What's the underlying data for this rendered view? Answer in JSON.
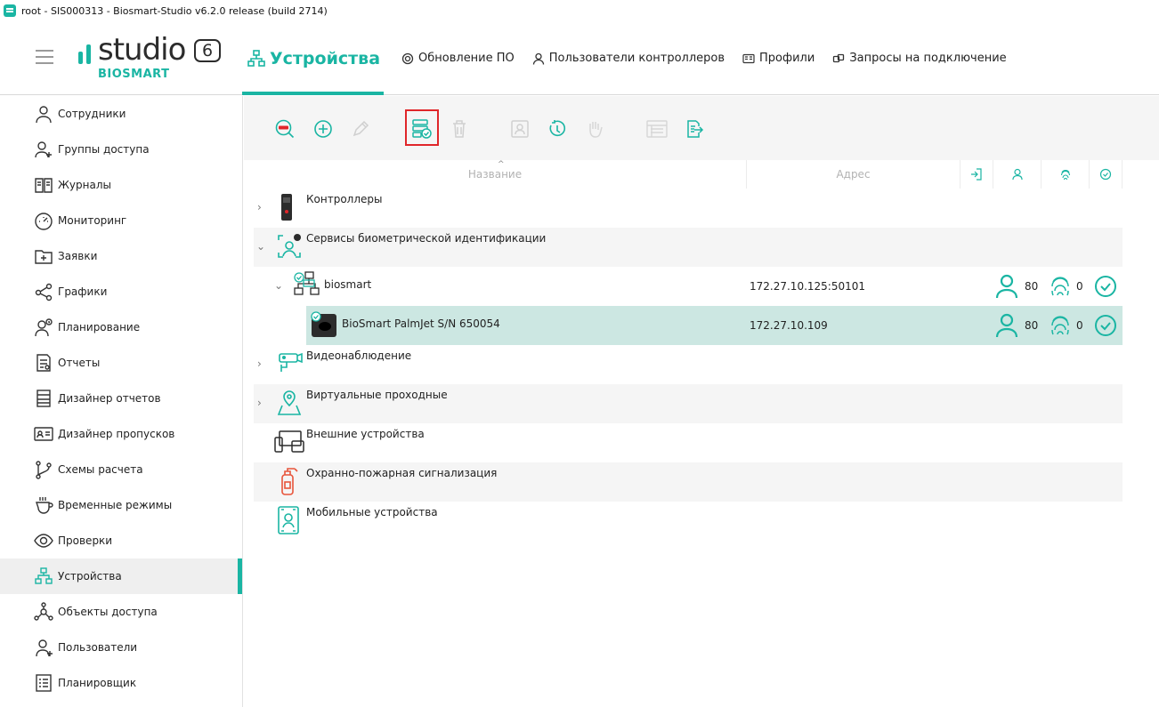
{
  "window": {
    "title": "root - SIS000313 - Biosmart-Studio v6.2.0 release (build 2714)"
  },
  "logo": {
    "word": "studio",
    "version": "6",
    "brand": "BIOSMART"
  },
  "nav": {
    "devices": "Устройства",
    "update": "Обновление ПО",
    "controller_users": "Пользователи контроллеров",
    "profiles": "Профили",
    "requests": "Запросы на подключение"
  },
  "sidebar": {
    "items": [
      {
        "label": "Сотрудники",
        "icon": "person-icon"
      },
      {
        "label": "Группы доступа",
        "icon": "group-icon"
      },
      {
        "label": "Журналы",
        "icon": "book-icon"
      },
      {
        "label": "Мониторинг",
        "icon": "gauge-icon"
      },
      {
        "label": "Заявки",
        "icon": "folder-plus-icon"
      },
      {
        "label": "Графики",
        "icon": "share-icon"
      },
      {
        "label": "Планирование",
        "icon": "person-clock-icon"
      },
      {
        "label": "Отчеты",
        "icon": "report-icon"
      },
      {
        "label": "Дизайнер отчетов",
        "icon": "report-designer-icon"
      },
      {
        "label": "Дизайнер пропусков",
        "icon": "badge-icon"
      },
      {
        "label": "Схемы расчета",
        "icon": "branch-icon"
      },
      {
        "label": "Временные режимы",
        "icon": "cup-icon"
      },
      {
        "label": "Проверки",
        "icon": "eye-icon"
      },
      {
        "label": "Устройства",
        "icon": "network-icon"
      },
      {
        "label": "Объекты доступа",
        "icon": "hub-icon"
      },
      {
        "label": "Пользователи",
        "icon": "user-plus-icon"
      },
      {
        "label": "Планировщик",
        "icon": "list-icon"
      }
    ],
    "active_index": 13
  },
  "grid": {
    "headers": {
      "name": "Название",
      "address": "Адрес"
    }
  },
  "tree": {
    "controllers": "Контроллеры",
    "bio_services": "Сервисы биометрической идентификации",
    "biosmart": {
      "label": "biosmart",
      "address": "172.27.10.125:50101",
      "users": "80",
      "fingers": "0"
    },
    "palmjet": {
      "label": "BioSmart PalmJet S/N 650054",
      "address": "172.27.10.109",
      "users": "80",
      "fingers": "0"
    },
    "video": "Видеонаблюдение",
    "virtual": "Виртуальные проходные",
    "external": "Внешние устройства",
    "fire": "Охранно-пожарная сигнализация",
    "mobile": "Мобильные устройства"
  },
  "colors": {
    "accent": "#1ab5a3",
    "selected_row": "#cce7e2",
    "highlight_box": "#e0262a"
  }
}
